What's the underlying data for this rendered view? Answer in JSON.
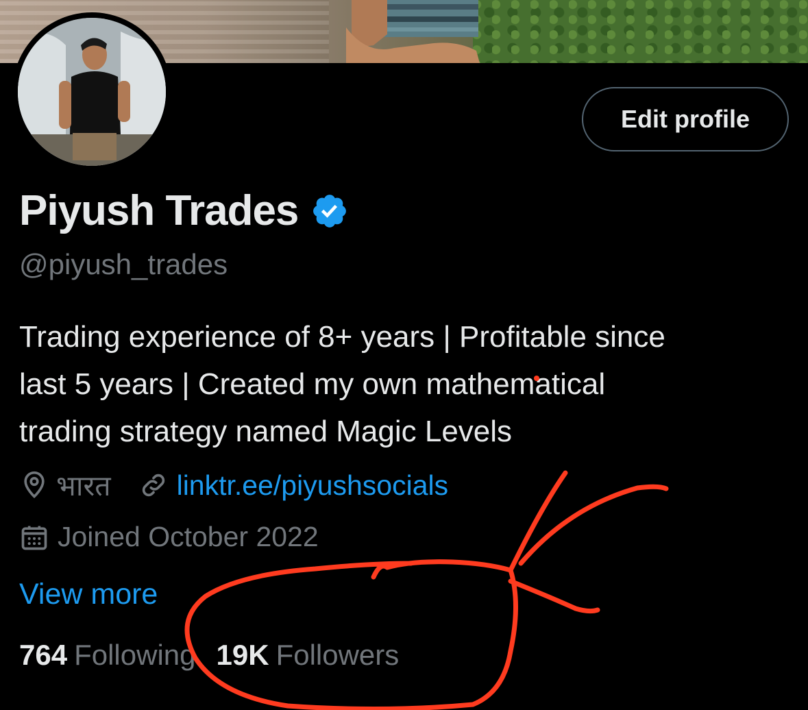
{
  "header": {
    "edit_profile_label": "Edit profile"
  },
  "profile": {
    "display_name": "Piyush Trades",
    "handle": "@piyush_trades",
    "verified": true,
    "bio_lines": [
      "Trading experience of 8+ years | Profitable since",
      "last 5 years | Created my own mathematical",
      "trading strategy named Magic Levels"
    ],
    "location": "भारत",
    "link": "linktr.ee/piyushsocials",
    "joined": "Joined October 2022",
    "view_more": "View more"
  },
  "stats": {
    "following_count": "764",
    "following_label": "Following",
    "followers_count": "19K",
    "followers_label": "Followers"
  },
  "colors": {
    "background": "#000000",
    "text_primary": "#e7e9ea",
    "text_secondary": "#71767b",
    "link": "#1d9bf0",
    "verified_badge": "#1d9bf0",
    "annotation": "#ff3b1f"
  },
  "icons": [
    "location-pin-icon",
    "link-icon",
    "calendar-icon",
    "verified-badge-icon"
  ]
}
